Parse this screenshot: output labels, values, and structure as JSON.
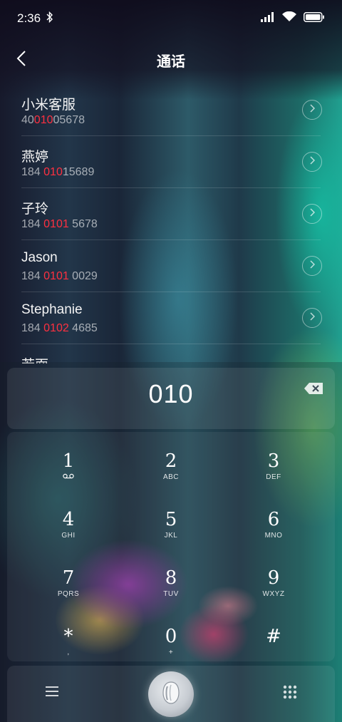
{
  "status_bar": {
    "time": "2:36",
    "icons": [
      "bluetooth-icon",
      "signal-icon",
      "wifi-icon",
      "battery-icon"
    ]
  },
  "header": {
    "title": "通话",
    "back_icon": "chevron-left-icon"
  },
  "contacts": [
    {
      "name": "小米客服",
      "number_prefix": "40",
      "number_match": "010",
      "number_suffix": "05678"
    },
    {
      "name": "燕婷",
      "number_prefix": "184 ",
      "number_match": "010",
      "number_suffix": "15689"
    },
    {
      "name": "子玲",
      "number_prefix": "184 ",
      "number_match": "0101",
      "number_suffix": " 5678"
    },
    {
      "name": "Jason",
      "number_prefix": "184 ",
      "number_match": "0101",
      "number_suffix": " 0029"
    },
    {
      "name": "Stephanie",
      "number_prefix": "184 ",
      "number_match": "0102",
      "number_suffix": " 4685"
    },
    {
      "name": "若面",
      "number_prefix": "",
      "number_match": "",
      "number_suffix": ""
    }
  ],
  "dialer": {
    "dialed_number": "010",
    "keys": [
      {
        "digit": "1",
        "sub": "voicemail-icon"
      },
      {
        "digit": "2",
        "sub": "ABC"
      },
      {
        "digit": "3",
        "sub": "DEF"
      },
      {
        "digit": "4",
        "sub": "GHI"
      },
      {
        "digit": "5",
        "sub": "JKL"
      },
      {
        "digit": "6",
        "sub": "MNO"
      },
      {
        "digit": "7",
        "sub": "PQRS"
      },
      {
        "digit": "8",
        "sub": "TUV"
      },
      {
        "digit": "9",
        "sub": "WXYZ"
      },
      {
        "digit": "*",
        "sub": ","
      },
      {
        "digit": "0",
        "sub": "+"
      },
      {
        "digit": "#",
        "sub": ""
      }
    ]
  },
  "colors": {
    "highlight": "#ff3040",
    "text": "#ffffff"
  }
}
